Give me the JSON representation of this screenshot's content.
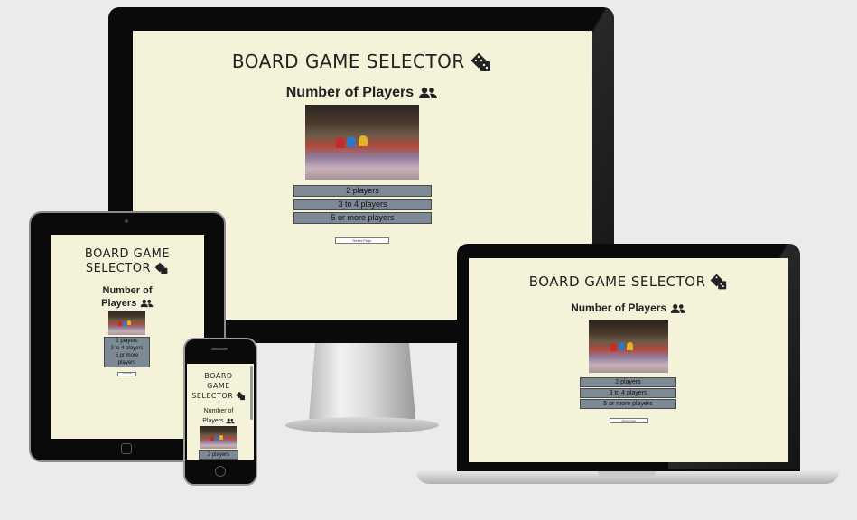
{
  "app": {
    "title": "BOARD GAME SELECTOR",
    "title_line1": "BOARD GAME",
    "title_line2": "SELECTOR",
    "title_mobile_1": "BOARD",
    "title_mobile_2": "GAME",
    "title_mobile_3": "SELECTOR",
    "subtitle": "Number of Players",
    "subtitle_line1": "Number of",
    "subtitle_line2": "Players",
    "options": [
      "2 players",
      "3 to 4 players",
      "5 or more players"
    ],
    "option_5_line1": "5 or more",
    "option_5_line2": "players",
    "reset_label": "Reset Page"
  },
  "icons": {
    "title_icon": "dice-icon",
    "subtitle_icon": "users-icon"
  },
  "colors": {
    "screen_bg": "#f4f3d9",
    "option_bg": "#7d8a96",
    "bezel": "#0a0a0a"
  }
}
